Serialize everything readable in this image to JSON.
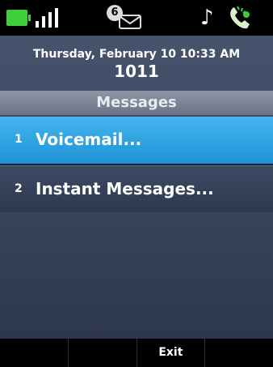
{
  "status": {
    "new_message_count": "6",
    "battery_color": "#3fcf3a",
    "icons": [
      "battery-icon",
      "signal-icon",
      "envelope-icon",
      "music-note-icon",
      "handset-icon"
    ]
  },
  "header": {
    "datetime": "Thursday, February 10 10:33 AM",
    "extension": "1011"
  },
  "screen_title": "Messages",
  "menu": {
    "items": [
      {
        "number": "1",
        "label": "Voicemail..."
      },
      {
        "number": "2",
        "label": "Instant Messages..."
      }
    ]
  },
  "softkeys": [
    "",
    "",
    "Exit",
    ""
  ],
  "colors": {
    "selected": "#1f94d6",
    "background": "#3c4860"
  }
}
